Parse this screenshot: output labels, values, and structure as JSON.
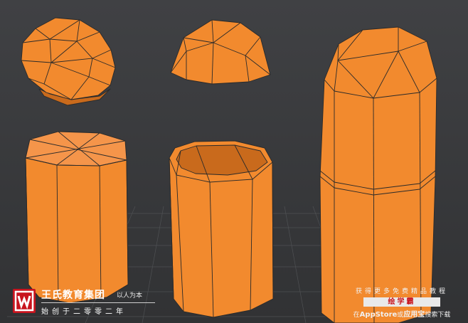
{
  "viewport": {
    "background_color": "#3a3b3d",
    "object_fill": "#f28a2e",
    "object_shade": "#d9701f",
    "wire_color": "#2a2a2a",
    "grid_color": "#5a5b5e"
  },
  "logo": {
    "icon": "wangshi-logo-icon",
    "title": "王氏教育集团",
    "tagline": "以人为本",
    "subtitle": "始创于二零零二年",
    "brand_color": "#c8141e"
  },
  "promo": {
    "line1": "获得更多免费精品教程",
    "badge": "绘学霸",
    "line3_prefix": "在",
    "line3_store": "AppStore",
    "line3_or": "或",
    "line3_app": "应用宝",
    "line3_suffix": "搜索下载"
  }
}
